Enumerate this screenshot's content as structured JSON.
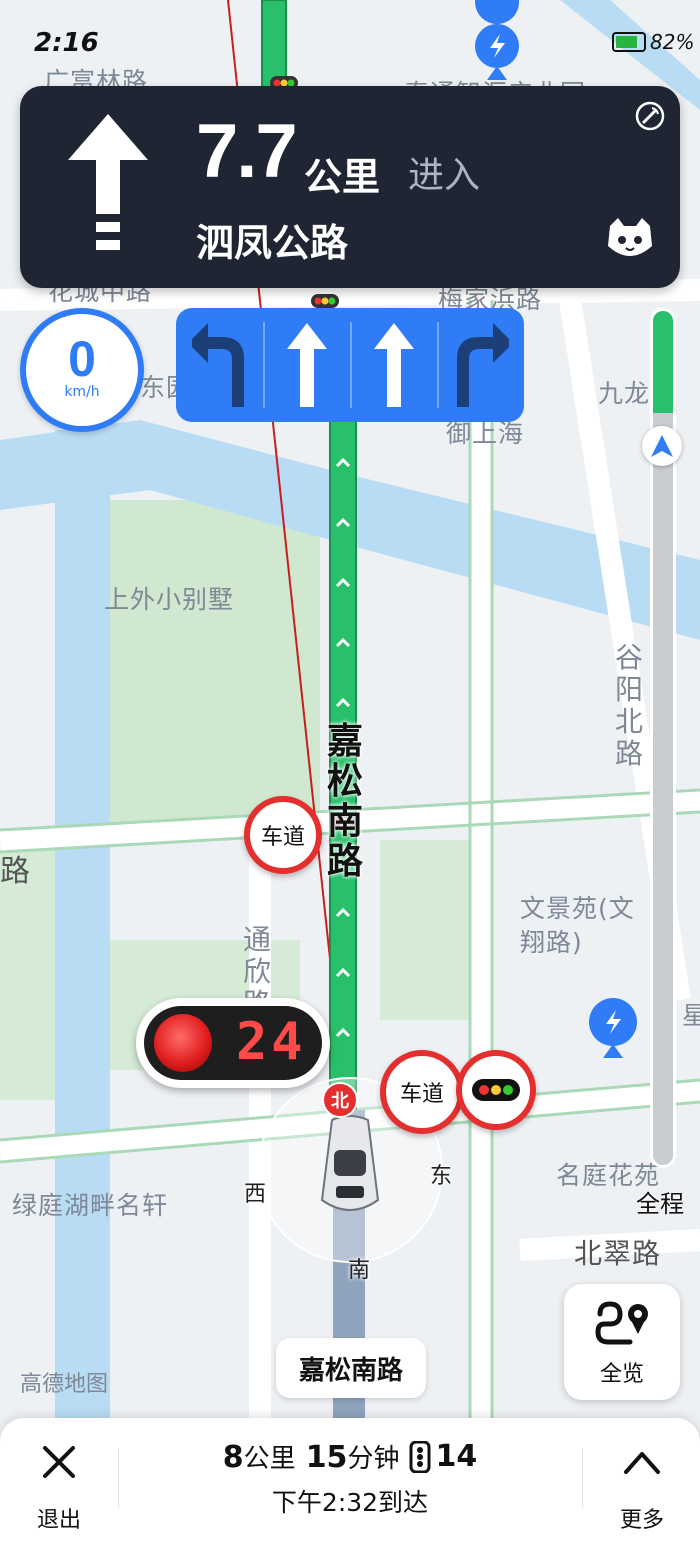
{
  "status_bar": {
    "time": "2:16",
    "battery": "82%"
  },
  "navigation": {
    "distance_value": "7.7",
    "distance_unit": "公里",
    "action": "进入",
    "next_road": "泗凤公路",
    "direction_icon": "straight-arrow-icon"
  },
  "speed": {
    "value": "0",
    "unit": "km/h"
  },
  "lanes": [
    "left-turn-arrow-icon",
    "straight-arrow-icon",
    "straight-arrow-icon",
    "right-turn-arrow-icon"
  ],
  "route_progress": {
    "label": "全程",
    "completed_fraction": 0.12
  },
  "traffic_light": {
    "countdown": "24",
    "color": "red"
  },
  "signs": {
    "lane_sign": "车道"
  },
  "compass": {
    "north": "北",
    "south": "南",
    "east": "东",
    "west": "西"
  },
  "map_labels": {
    "guangfulin_road": "广富林路",
    "yitong_center": "泰通智汇产业园",
    "huacheng_road": "花城中路",
    "meijiabang_road": "梅家浜路",
    "dongyuan": "东园",
    "jiulongjiang": "九龙江",
    "yushanghai": "御上海",
    "shangwai_villa": "上外小别墅",
    "jiasong_south_road": "嘉松南路",
    "guyang_north_road": "谷阳北路",
    "left_road": "路",
    "tongxin_road": "通欣路",
    "wenjingyuan": "文景苑(文翔路)",
    "lvting": "绿庭湖畔名轩",
    "mingtinghuayuan": "名庭花苑",
    "beicui_road": "北翠路",
    "xing": "星",
    "current_road": "嘉松南路",
    "watermark": "高德地图"
  },
  "overview_button": {
    "label": "全览"
  },
  "bottom_bar": {
    "exit_label": "退出",
    "remaining_distance": "8",
    "distance_unit": "公里",
    "remaining_time": "15",
    "time_unit": "分钟",
    "traffic_lights_remaining": "14",
    "eta": "下午2:32到达",
    "more_label": "更多"
  },
  "colors": {
    "route_green": "#28c06a",
    "accent_blue": "#2f7cf6",
    "nav_card": "#1f2532",
    "sign_red": "#e3302f"
  }
}
